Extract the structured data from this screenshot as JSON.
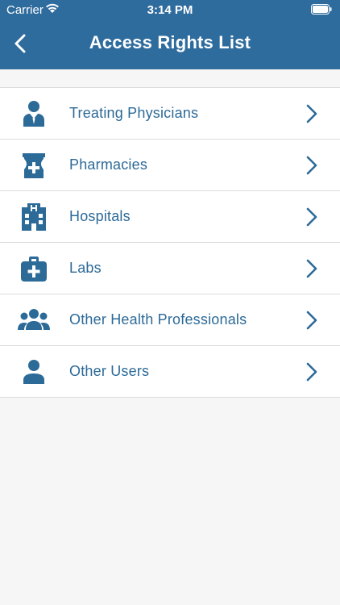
{
  "status_bar": {
    "carrier": "Carrier",
    "time": "3:14 PM"
  },
  "header": {
    "title": "Access Rights List"
  },
  "list": {
    "items": [
      {
        "label": "Treating Physicians",
        "icon": "physician-icon"
      },
      {
        "label": "Pharmacies",
        "icon": "pharmacy-icon"
      },
      {
        "label": "Hospitals",
        "icon": "hospital-icon"
      },
      {
        "label": "Labs",
        "icon": "medical-kit-icon"
      },
      {
        "label": "Other Health Professionals",
        "icon": "group-icon"
      },
      {
        "label": "Other Users",
        "icon": "user-icon"
      }
    ]
  },
  "colors": {
    "header_bg": "#2f6c9e",
    "accent": "#2c6a98",
    "background": "#f6f6f6",
    "row_bg": "#ffffff",
    "divider": "#dcdcdc"
  }
}
